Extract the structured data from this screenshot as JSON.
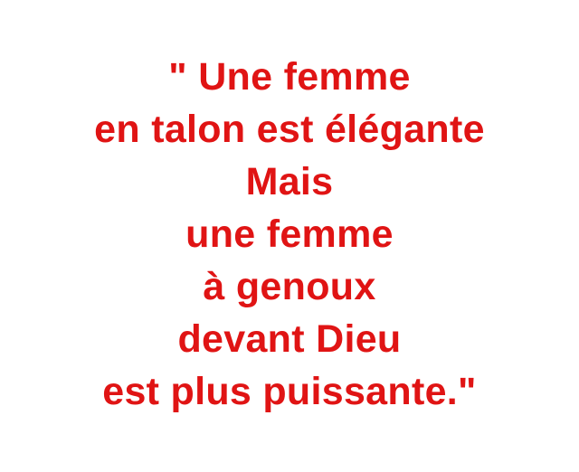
{
  "quote": {
    "color": "#e01414",
    "lines": [
      "\" Une femme",
      "en talon est élégante",
      "Mais",
      "une femme",
      "à genoux",
      "devant Dieu",
      "est plus puissante.\""
    ]
  }
}
